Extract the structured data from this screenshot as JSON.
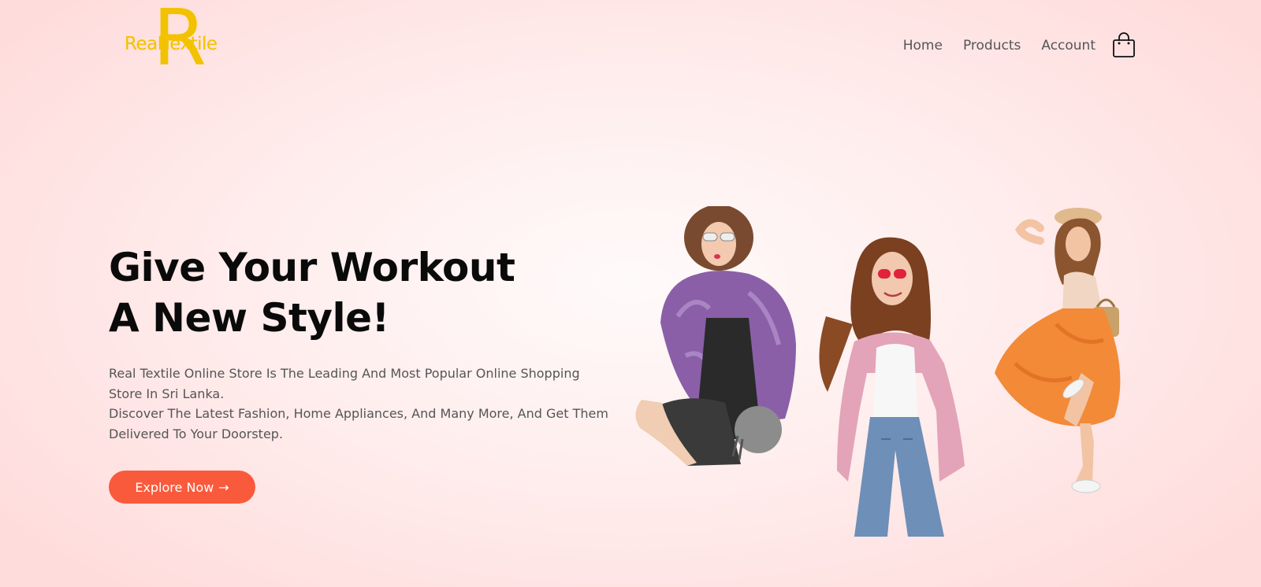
{
  "brand": {
    "logo_letter": "R",
    "name": "RealTextile",
    "color": "#f4c300"
  },
  "nav": {
    "items": [
      "Home",
      "Products",
      "Account"
    ],
    "cart_icon": "shopping-bag-icon"
  },
  "hero": {
    "title_line1": "Give Your Workout",
    "title_line2": "A New Style!",
    "desc_line1": "Real Textile Online Store Is The Leading And Most Popular Online Shopping",
    "desc_line2": "Store In Sri Lanka.",
    "desc_line3": "Discover The Latest Fashion, Home Appliances, And Many More, And Get Them",
    "desc_line4": "Delivered To Your Doorstep.",
    "cta_label": "Explore Now",
    "cta_arrow": "→"
  },
  "colors": {
    "accent": "#fa5a3c",
    "text_dark": "#0a0a0a",
    "text_muted": "#555555"
  }
}
